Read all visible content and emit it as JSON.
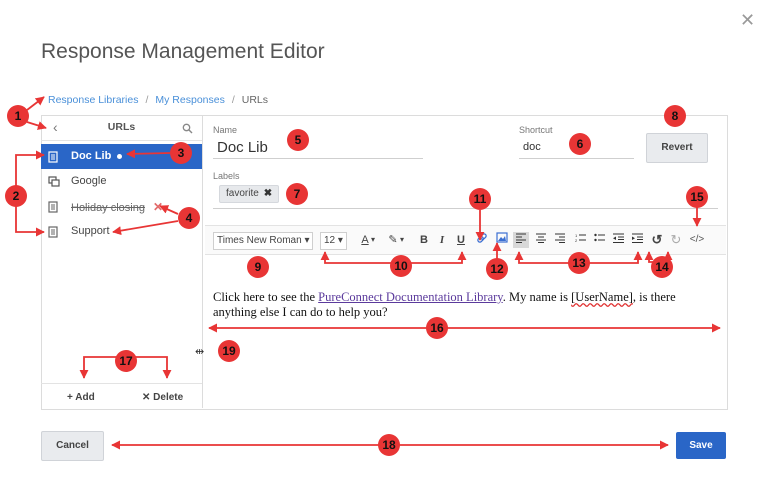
{
  "dialog": {
    "title": "Response Management Editor"
  },
  "breadcrumb": {
    "items": [
      "Response Libraries",
      "My Responses",
      "URLs"
    ],
    "separator": "/"
  },
  "left_panel": {
    "title": "URLs",
    "items": [
      {
        "label": "Doc Lib"
      },
      {
        "label": "Google"
      },
      {
        "label": "Holiday closing"
      },
      {
        "label": "Support"
      }
    ],
    "add_label": "+ Add",
    "delete_label": "✕ Delete"
  },
  "form": {
    "name_label": "Name",
    "name_value": "Doc Lib",
    "shortcut_label": "Shortcut",
    "shortcut_value": "doc",
    "revert_label": "Revert",
    "labels_label": "Labels",
    "label_chip": "favorite"
  },
  "toolbar": {
    "font": "Times New Roman",
    "size": "12"
  },
  "editor": {
    "text_before": "Click here to see the ",
    "link_text": "PureConnect Documentation Library",
    "text_mid": ". My name is ",
    "placeholder": "[UserName]",
    "text_after": ", is there anything else I can do to help you?"
  },
  "footer": {
    "cancel_label": "Cancel",
    "save_label": "Save"
  },
  "callouts": [
    "1",
    "2",
    "3",
    "4",
    "5",
    "6",
    "7",
    "8",
    "9",
    "10",
    "11",
    "12",
    "13",
    "14",
    "15",
    "16",
    "17",
    "18",
    "19"
  ],
  "colors": {
    "accent": "#2a66c7",
    "callout": "#e83535",
    "link": "#4a90d9"
  }
}
